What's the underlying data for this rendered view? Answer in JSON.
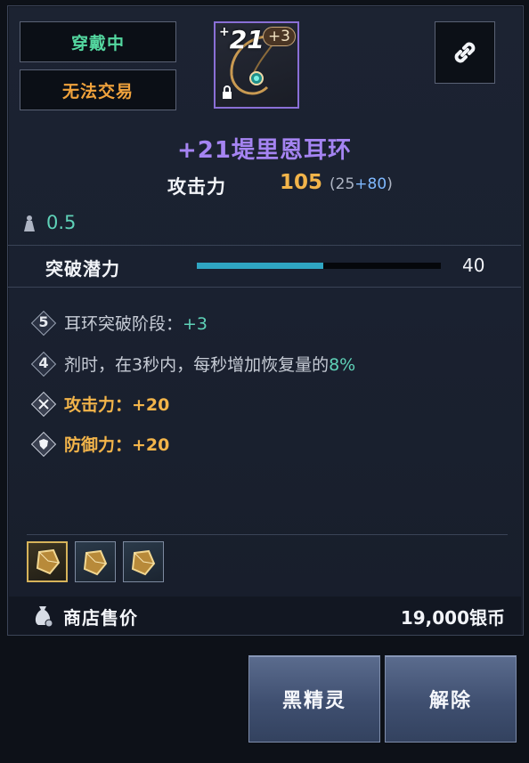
{
  "tags": {
    "equipped": "穿戴中",
    "no_trade": "无法交易"
  },
  "item": {
    "enhance_level": "21",
    "enhance_prefix": "+",
    "bonus_badge": "+3",
    "name": "+21堤里恩耳环",
    "icon": "earring-icon",
    "lock_icon": "lock-icon"
  },
  "attack": {
    "label": "攻击力",
    "value": "105",
    "base_prefix": "(25",
    "bonus": "+80",
    "suffix": ")"
  },
  "weight": {
    "value": "0.5",
    "icon": "weight-icon"
  },
  "breakthrough": {
    "label": "突破潜力",
    "value": "40",
    "fill_fraction": 0.52,
    "fill_color": "#2fa5c2"
  },
  "effects": [
    {
      "badge": "5",
      "text": "耳环突破阶段：",
      "value": "+3"
    },
    {
      "badge": "4",
      "text": "剂时，在3秒内，每秒增加恢复量的",
      "value": "8%"
    },
    {
      "icon": "crossed-swords-icon",
      "text": "攻击力：+20"
    },
    {
      "icon": "shield-icon",
      "text": "防御力：+20"
    }
  ],
  "gems": [
    {
      "icon": "gem-icon",
      "selected": true
    },
    {
      "icon": "gem-icon",
      "selected": false
    },
    {
      "icon": "gem-icon",
      "selected": false
    }
  ],
  "sell": {
    "label": "商店售价",
    "value": "19,000银币",
    "icon": "money-bag-icon"
  },
  "buttons": {
    "primary": "黑精灵",
    "secondary": "解除"
  },
  "colors": {
    "equipped": "#54d8a0",
    "no_trade": "#f0a23c",
    "item_name": "#a584f2",
    "attack_value": "#f2b44a",
    "accent_teal": "#5fd2b8"
  }
}
